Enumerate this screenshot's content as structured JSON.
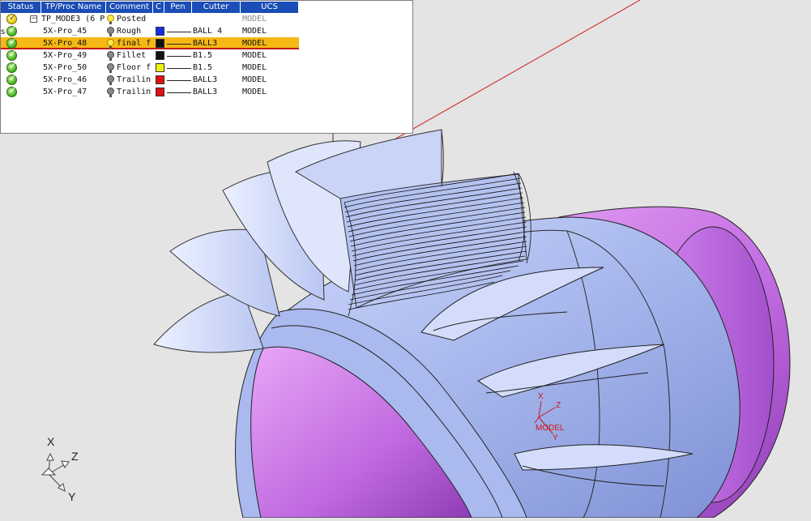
{
  "operations_table": {
    "headers": [
      "Status",
      "TP/Proc Name",
      "Comment",
      "C",
      "Pen",
      "Cutter",
      "UCS"
    ],
    "rows": [
      {
        "status": "posted",
        "name": "TP_MODE3 (6 P",
        "bulb": "on",
        "comment": "Posted",
        "color": "",
        "cutter": "",
        "ucs": "MODEL",
        "group": true,
        "selected": false
      },
      {
        "status": "ok",
        "name": "5X-Pro_45",
        "bulb": "off",
        "comment": "Rough",
        "color": "#1030e6",
        "cutter": "BALL 4",
        "ucs": "MODEL",
        "group": false,
        "selected": false
      },
      {
        "status": "ok",
        "name": "5X-Pro_48",
        "bulb": "on",
        "comment": "final f",
        "color": "#111111",
        "cutter": "BALL3",
        "ucs": "MODEL",
        "group": false,
        "selected": true
      },
      {
        "status": "ok",
        "name": "5X-Pro_49",
        "bulb": "off",
        "comment": "Fillet",
        "color": "#111111",
        "cutter": "B1.5",
        "ucs": "MODEL",
        "group": false,
        "selected": false
      },
      {
        "status": "ok",
        "name": "5X-Pro_50",
        "bulb": "off",
        "comment": "Floor f",
        "color": "#f2f20a",
        "cutter": "B1.5",
        "ucs": "MODEL",
        "group": false,
        "selected": false
      },
      {
        "status": "ok",
        "name": "5X-Pro_46",
        "bulb": "off",
        "comment": "Trailin",
        "color": "#e01010",
        "cutter": "BALL3",
        "ucs": "MODEL",
        "group": false,
        "selected": false
      },
      {
        "status": "ok",
        "name": "5X-Pro_47",
        "bulb": "off",
        "comment": "Trailin",
        "color": "#e01010",
        "cutter": "BALL3",
        "ucs": "MODEL",
        "group": false,
        "selected": false
      }
    ]
  },
  "side_marker": "s",
  "model_ucs": {
    "x": "X",
    "y": "Y",
    "z": "Z",
    "label": "MODEL",
    "color": "#d01818"
  },
  "triad": {
    "x": "X",
    "y": "Y",
    "z": "Z"
  },
  "colors": {
    "header_bg": "#1b4db7",
    "selection": "#f5b814",
    "part_blue": "#a9b9ee",
    "part_magenta": "#c772e8",
    "toolpath_line": "#d01818"
  }
}
